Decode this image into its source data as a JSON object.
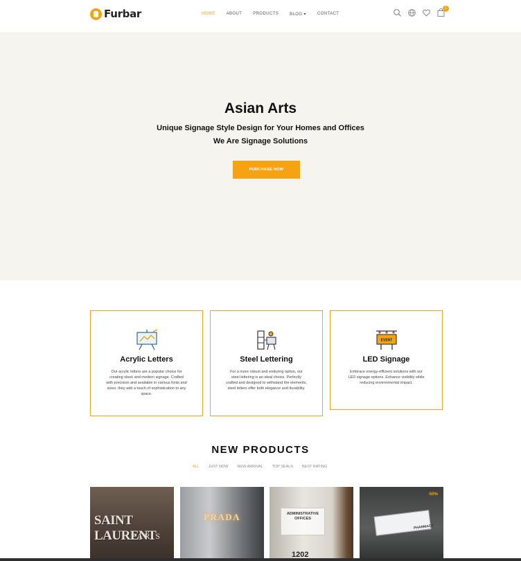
{
  "header": {
    "logo": "Furbar",
    "nav": [
      "HOME",
      "ABOUT",
      "PRODUCTS",
      "BLOG",
      "CONTACT"
    ],
    "blog_caret": "▾",
    "cart_count": "1"
  },
  "hero": {
    "title": "Asian Arts",
    "subtitle1": "Unique Signage Style Design for Your Homes and Offices",
    "subtitle2": "We Are Signage Solutions",
    "button": "PURCHASE NOW"
  },
  "features": [
    {
      "title": "Acrylic Letters",
      "text": "Our acrylic letters are a popular choice for creating sleek and modern signage. Crafted with precision and available in various fonts and sizes, they add a touch of sophistication to any space.",
      "icon": "easel-icon"
    },
    {
      "title": "Steel Lettering",
      "text": "For a more robust and enduring option, our steel lettering is an ideal choice. Perfectly crafted and designed to withstand the elements, steel letters offer both elegance and durability.",
      "icon": "steel-letters-icon"
    },
    {
      "title": "LED Signage",
      "text": "Embrace energy-efficient solutions with our LED signage options. Enhance visibility while reducing environmental impact.",
      "icon": "event-board-icon",
      "icon_label": "EVENT"
    }
  ],
  "new_products": {
    "title": "NEW PRODUCTS",
    "filters": [
      "ALL",
      "JUST NOW",
      "NEW ARRIVAL",
      "TOP SEALS",
      "BEST RATING"
    ]
  },
  "products": [
    {
      "line1": "SAINT LAURENT",
      "line2": "PARIS"
    },
    {
      "line1": "PRADA"
    },
    {
      "line1": "ADMINISTRATIVE OFFICES",
      "number": "1202"
    },
    {
      "line1": "PHARMACY",
      "badge": "-50%"
    }
  ],
  "colors": {
    "accent": "#f5a313",
    "hero_bg": "#f6f4ee"
  }
}
